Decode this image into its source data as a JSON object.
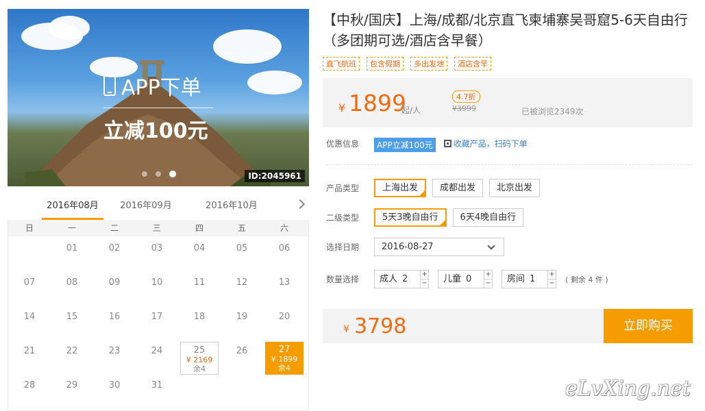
{
  "hero": {
    "app_text": "APP下单",
    "reduce_text": "立减100元",
    "id_badge": "ID:2045961"
  },
  "calendar": {
    "tabs": [
      "2016年08月",
      "2016年09月",
      "2016年10月"
    ],
    "weekdays": [
      "日",
      "一",
      "二",
      "三",
      "四",
      "五",
      "六"
    ],
    "rows": [
      [
        "",
        "01",
        "02",
        "03",
        "04",
        "05",
        "06"
      ],
      [
        "07",
        "08",
        "09",
        "10",
        "11",
        "12",
        "13"
      ],
      [
        "14",
        "15",
        "16",
        "17",
        "18",
        "19",
        "20"
      ],
      [
        "21",
        "22",
        "23",
        "24",
        "25",
        "26",
        "27"
      ],
      [
        "28",
        "29",
        "30",
        "31",
        "",
        "",
        ""
      ]
    ],
    "avail_25": {
      "day": "25",
      "price": "¥ 2169",
      "left": "余4"
    },
    "avail_27": {
      "day": "27",
      "price": "¥ 1899",
      "left": "余4"
    }
  },
  "product": {
    "title": "【中秋/国庆】上海/成都/北京直飞柬埔寨吴哥窟5-6天自由行（多团期可选/酒店含早餐）",
    "tags": [
      "直飞航班",
      "包含假期",
      "多出发地",
      "酒店含早"
    ]
  },
  "price": {
    "yen": "¥",
    "value": "1899",
    "unit": "起/人",
    "discount": "4.7折",
    "old": "¥3999",
    "views": "已被浏览2349次"
  },
  "promo": {
    "label": "优惠信息",
    "badge": "APP立减100元",
    "link": "收藏产品，扫码下单"
  },
  "options": {
    "type_label": "产品类型",
    "types": [
      "上海出发",
      "成都出发",
      "北京出发"
    ],
    "sub_label": "二级类型",
    "subs": [
      "5天3晚自由行",
      "6天4晚自由行"
    ],
    "date_label": "选择日期",
    "date_value": "2016-08-27",
    "qty_label": "数量选择",
    "adult": {
      "label": "成人",
      "value": "2"
    },
    "child": {
      "label": "儿童",
      "value": "0"
    },
    "room": {
      "label": "房间",
      "value": "1"
    },
    "stepper_plus": "+",
    "stepper_minus": "−",
    "remain": "( 剩余 4 件 )"
  },
  "buy": {
    "yen": "¥",
    "total": "3798",
    "button": "立即购买"
  },
  "watermark": "eLvXing.net",
  "colors": {
    "accent": "#f49c00",
    "price": "#f06a10",
    "promo": "#4d9ee8"
  }
}
